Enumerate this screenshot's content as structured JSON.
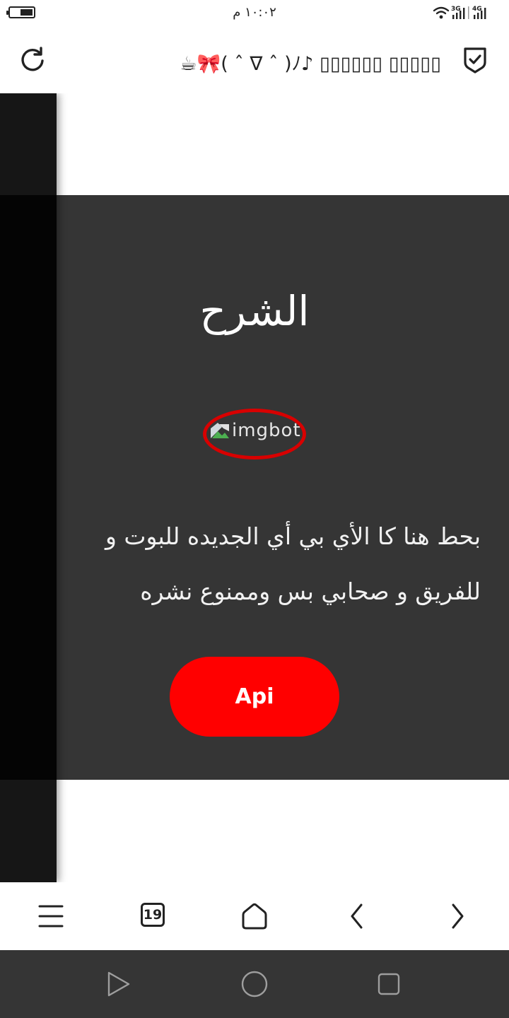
{
  "status_bar": {
    "time": "١٠:٠٢ م",
    "battery_level": 0.55,
    "network_labels": [
      "3G",
      "4G"
    ]
  },
  "top_bar": {
    "page_title": "☕🎀( ˆ ∇ ˆ )ﾉ♪ ▯▯▯▯▯▯ ▯▯▯▯▯"
  },
  "panel": {
    "title": "الشرح",
    "image_alt": "imgbot",
    "description": "بحط هنا كا الأي بي أي الجديده للبوت و\nللفريق و صحابي بس وممنوع نشره",
    "button_label": "Api"
  },
  "bottom_bar": {
    "tab_count": "19"
  },
  "colors": {
    "panel_bg": "#353535",
    "accent": "#ff0000",
    "annotation": "#d80000",
    "nav_bg": "#353535"
  },
  "icons": {
    "reload": "reload-icon",
    "shield": "shield-check-icon",
    "menu": "menu-icon",
    "home": "home-icon",
    "back": "chevron-left-icon",
    "forward": "chevron-right-icon"
  }
}
